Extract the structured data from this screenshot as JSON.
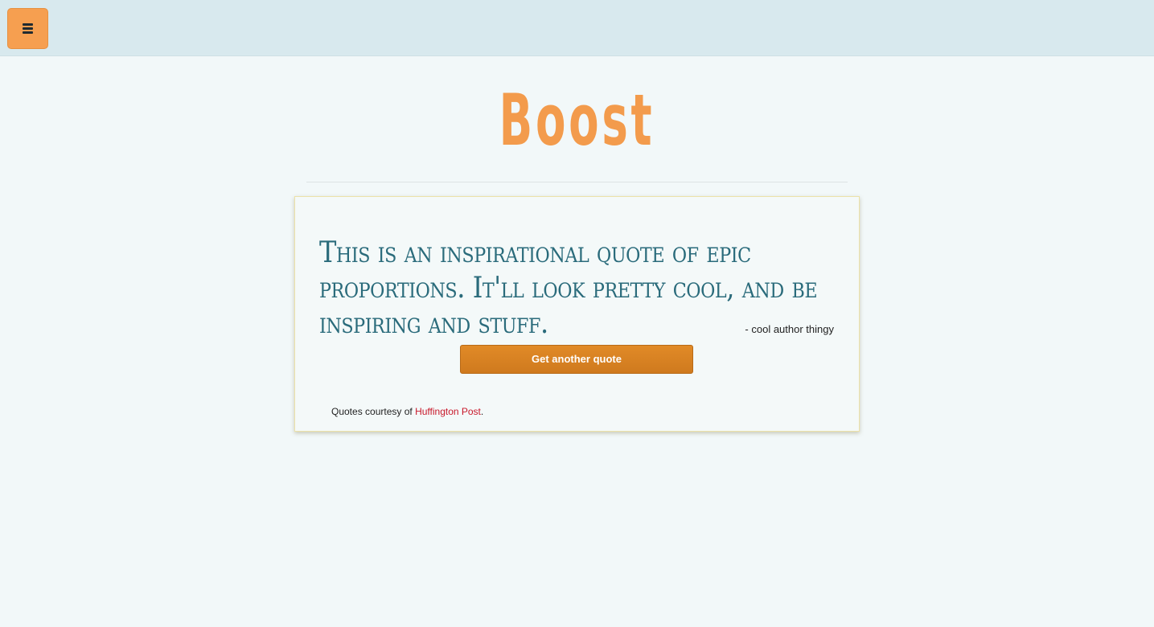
{
  "header": {
    "menu_icon": "hamburger-icon"
  },
  "page": {
    "title": "Boost"
  },
  "quote_card": {
    "quote": "This is an inspirational quote of epic proportions. It'll look pretty cool, and be inspiring and stuff.",
    "author": "- cool author thingy",
    "button_label": "Get another quote",
    "credit_prefix": "Quotes courtesy of ",
    "credit_link": "Huffington Post",
    "credit_suffix": "."
  },
  "colors": {
    "accent_orange": "#f39b4c",
    "button_orange": "#d9821f",
    "quote_teal": "#2a6b7b",
    "link_red": "#c8182a",
    "topbar_bg": "#d8e9ee",
    "page_bg": "#f2f8f9"
  }
}
